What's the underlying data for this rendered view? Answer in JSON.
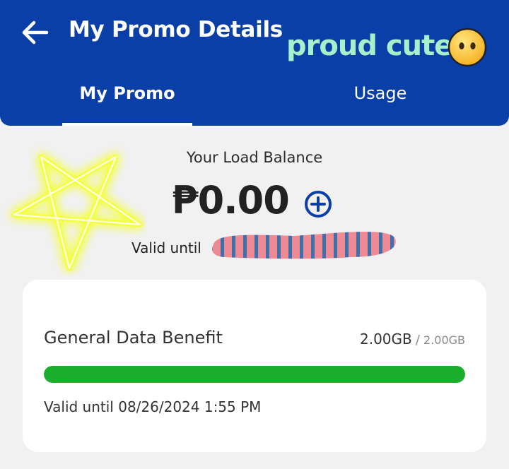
{
  "header": {
    "title": "My Promo Details",
    "back_icon": "arrow-left-icon",
    "background": "#0b3fa8"
  },
  "sticker": {
    "text": "proud cute",
    "emoji_icon": "face-without-mouth-emoji",
    "text_color": "#a8efcb"
  },
  "tabs": [
    {
      "label": "My Promo",
      "active": true
    },
    {
      "label": "Usage",
      "active": false
    }
  ],
  "balance": {
    "label": "Your Load Balance",
    "amount": "₱0.00",
    "add_icon": "plus-circle-icon",
    "valid_label": "Valid until",
    "valid_value_redacted": true
  },
  "decoration": {
    "star_icon": "glowing-star-doodle",
    "star_color": "#f4ff3a"
  },
  "benefit": {
    "name": "General Data Benefit",
    "used": "2.00GB",
    "separator": "/",
    "total": "2.00GB",
    "remaining_fraction": 1.0,
    "progress_color": "#1aae2a",
    "valid": "Valid until 08/26/2024 1:55 PM"
  }
}
